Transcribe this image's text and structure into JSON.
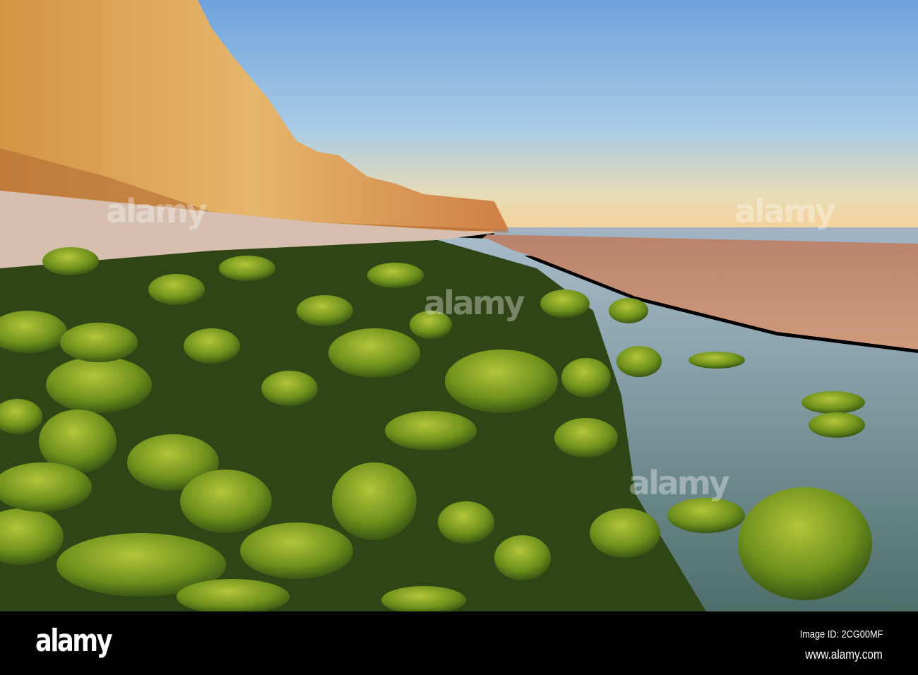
{
  "photo": {
    "subject": "mossy-rocks-beach-cliffs-sunset",
    "colors": {
      "sky_top": "#6fa3dc",
      "sky_horizon": "#f3d9a0",
      "cliff": "#d99a4a",
      "sand": "#c99076",
      "moss": "#7d9a1f",
      "water": "#7f9fb5"
    }
  },
  "watermark": {
    "text": "alamy"
  },
  "footer": {
    "logo": "alamy",
    "image_id": "Image ID: 2CG00MF",
    "url": "www.alamy.com"
  }
}
